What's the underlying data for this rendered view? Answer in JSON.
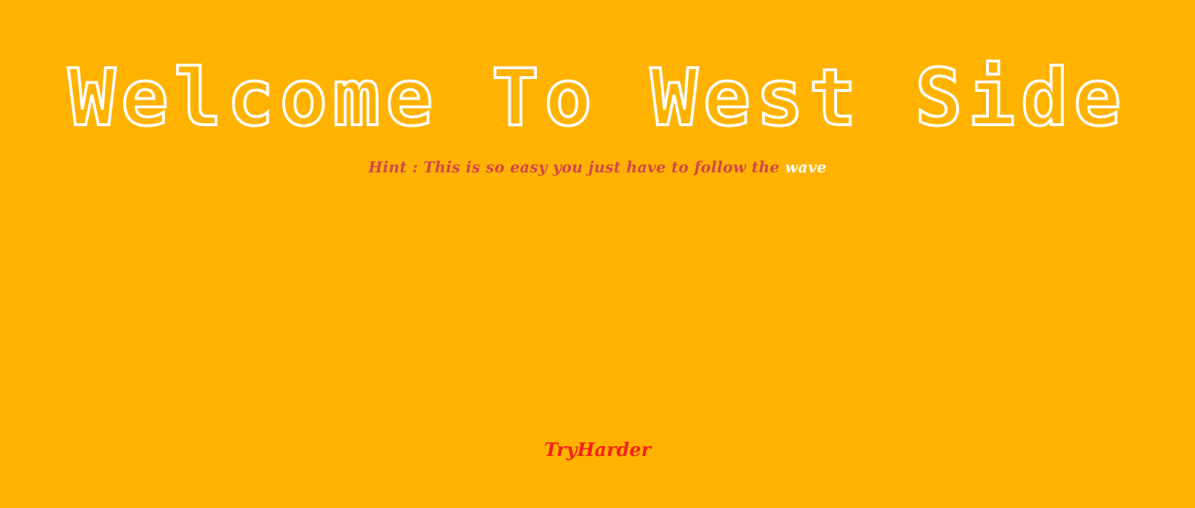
{
  "page": {
    "background_color": "#FFB300"
  },
  "header": {
    "title": "Welcome To West Side",
    "title_color": "#FFFFFF"
  },
  "hint": {
    "prefix": "Hint : This is so easy you just have to follow the ",
    "link_text": "wave",
    "text_color": "#D2474B",
    "link_color": "#FFFFFF"
  },
  "footer": {
    "link_text": "TryHarder",
    "color": "#F0241B"
  }
}
